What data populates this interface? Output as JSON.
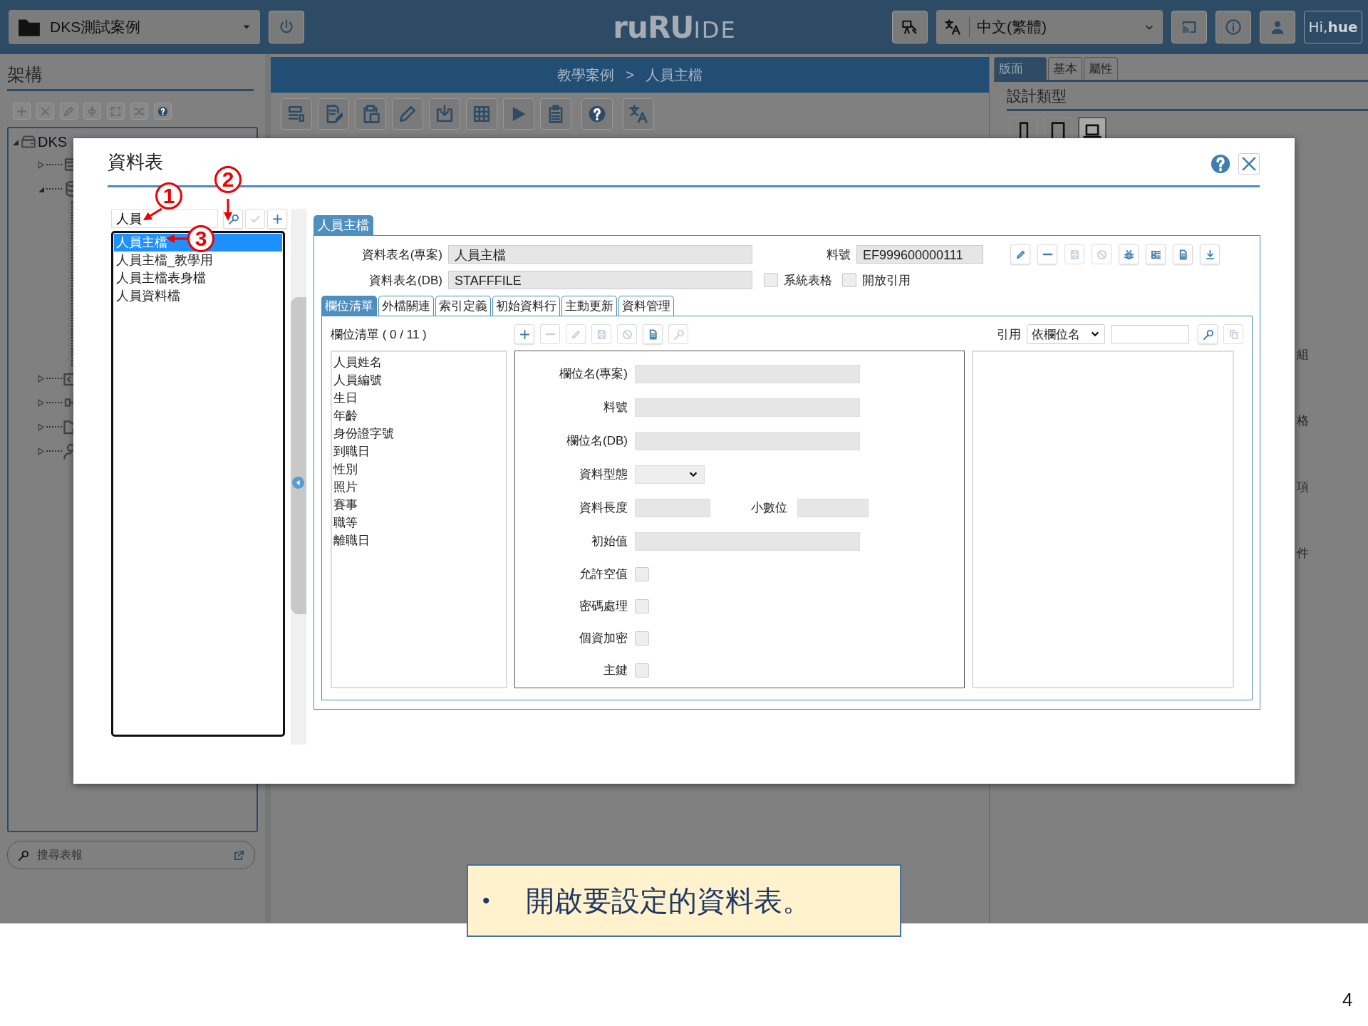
{
  "topbar": {
    "project": "DKS測試案例",
    "logo": {
      "bold": "ruRU",
      "light": "IDE"
    },
    "language": "中文(繁體)",
    "greeting": "Hi,**hue**"
  },
  "left_panel": {
    "title": "架構",
    "tree": {
      "label": "DKS",
      "expanded": true,
      "children": [
        {
          "kind": "form",
          "expanded": false
        },
        {
          "kind": "database",
          "expanded": true
        },
        {
          "kind": "code",
          "expanded": false
        },
        {
          "kind": "workflow",
          "expanded": false
        },
        {
          "kind": "foldergear",
          "expanded": false
        },
        {
          "kind": "usergear",
          "expanded": false
        }
      ]
    },
    "search": {
      "placeholder": "搜尋表報"
    }
  },
  "center": {
    "breadcrumb": [
      "教學案例",
      "人員主檔"
    ],
    "separator": ">"
  },
  "right_panel": {
    "tabs": [
      {
        "label": "版面",
        "selected": true
      },
      {
        "label": "基本",
        "selected": false
      },
      {
        "label": "屬性",
        "selected": false
      }
    ],
    "section": "設計類型",
    "devices": [
      {
        "kind": "phone",
        "selected": false
      },
      {
        "kind": "tablet",
        "selected": false
      },
      {
        "kind": "laptop",
        "selected": true
      }
    ],
    "fragments": [
      "組",
      "格",
      "項",
      "件"
    ]
  },
  "dialog": {
    "title": "資料表",
    "search": {
      "value": "人員"
    },
    "search_tools": [
      {
        "kind": "search",
        "disabled": false
      },
      {
        "kind": "check",
        "disabled": true
      },
      {
        "kind": "add",
        "disabled": false
      }
    ],
    "tables": [
      {
        "label": "人員主檔",
        "selected": true
      },
      {
        "label": "人員主檔_教學用",
        "selected": false
      },
      {
        "label": "人員主檔表身檔",
        "selected": false
      },
      {
        "label": "人員資料檔",
        "selected": false
      }
    ],
    "annotations": [
      {
        "number": "1"
      },
      {
        "number": "2"
      },
      {
        "number": "3"
      }
    ],
    "tab": "人員主檔",
    "name_project": {
      "label": "資料表名(專案)",
      "value": "人員主檔"
    },
    "part_no": {
      "label": "料號",
      "value": "EF999600000111"
    },
    "name_db": {
      "label": "資料表名(DB)",
      "value": "STAFFFILE"
    },
    "options": [
      {
        "label": "系統表格",
        "checked": false
      },
      {
        "label": "開放引用",
        "checked": false
      }
    ],
    "table_tools": [
      {
        "kind": "edit",
        "disabled": false
      },
      {
        "kind": "minus",
        "disabled": false
      },
      {
        "kind": "save",
        "disabled": true
      },
      {
        "kind": "ban",
        "disabled": true
      },
      {
        "kind": "bug",
        "disabled": false
      },
      {
        "kind": "list",
        "disabled": false
      },
      {
        "kind": "doc",
        "disabled": false
      },
      {
        "kind": "download",
        "disabled": false
      }
    ],
    "tabs": [
      {
        "label": "欄位清單",
        "selected": true
      },
      {
        "label": "外檔關連",
        "selected": false
      },
      {
        "label": "索引定義",
        "selected": false
      },
      {
        "label": "初始資料行",
        "selected": false
      },
      {
        "label": "主動更新",
        "selected": false
      },
      {
        "label": "資料管理",
        "selected": false
      }
    ],
    "field_list": {
      "title": "欄位清單 ( 0 / 11 )",
      "tools": [
        {
          "kind": "add",
          "disabled": false
        },
        {
          "kind": "minus",
          "disabled": true
        },
        {
          "kind": "edit",
          "disabled": true
        },
        {
          "kind": "save",
          "disabled": true
        },
        {
          "kind": "ban",
          "disabled": true
        },
        {
          "kind": "doc",
          "disabled": false
        },
        {
          "kind": "search",
          "disabled": true
        }
      ],
      "items": [
        "人員姓名",
        "人員編號",
        "生日",
        "年齡",
        "身份證字號",
        "到職日",
        "性別",
        "照片",
        "賽事",
        "職等",
        "離職日"
      ]
    },
    "reference": {
      "label": "引用",
      "mode": "依欄位名",
      "tools": [
        {
          "kind": "search",
          "disabled": false
        },
        {
          "kind": "copy",
          "disabled": true
        }
      ]
    },
    "form": [
      {
        "kind": "text",
        "label": "欄位名(專案)"
      },
      {
        "kind": "text",
        "label": "料號"
      },
      {
        "kind": "text",
        "label": "欄位名(DB)"
      },
      {
        "kind": "select",
        "label": "資料型態"
      },
      {
        "kind": "pair",
        "label": "資料長度",
        "label2": "小數位"
      },
      {
        "kind": "text",
        "label": "初始值"
      },
      {
        "kind": "checkbox",
        "label": "允許空值",
        "checked": false
      },
      {
        "kind": "checkbox",
        "label": "密碼處理",
        "checked": false
      },
      {
        "kind": "checkbox",
        "label": "個資加密",
        "checked": false
      },
      {
        "kind": "checkbox",
        "label": "主鍵",
        "checked": false
      }
    ]
  },
  "caption": {
    "bullet": "•",
    "text": "開啟要設定的資料表。"
  },
  "page_number": "4"
}
